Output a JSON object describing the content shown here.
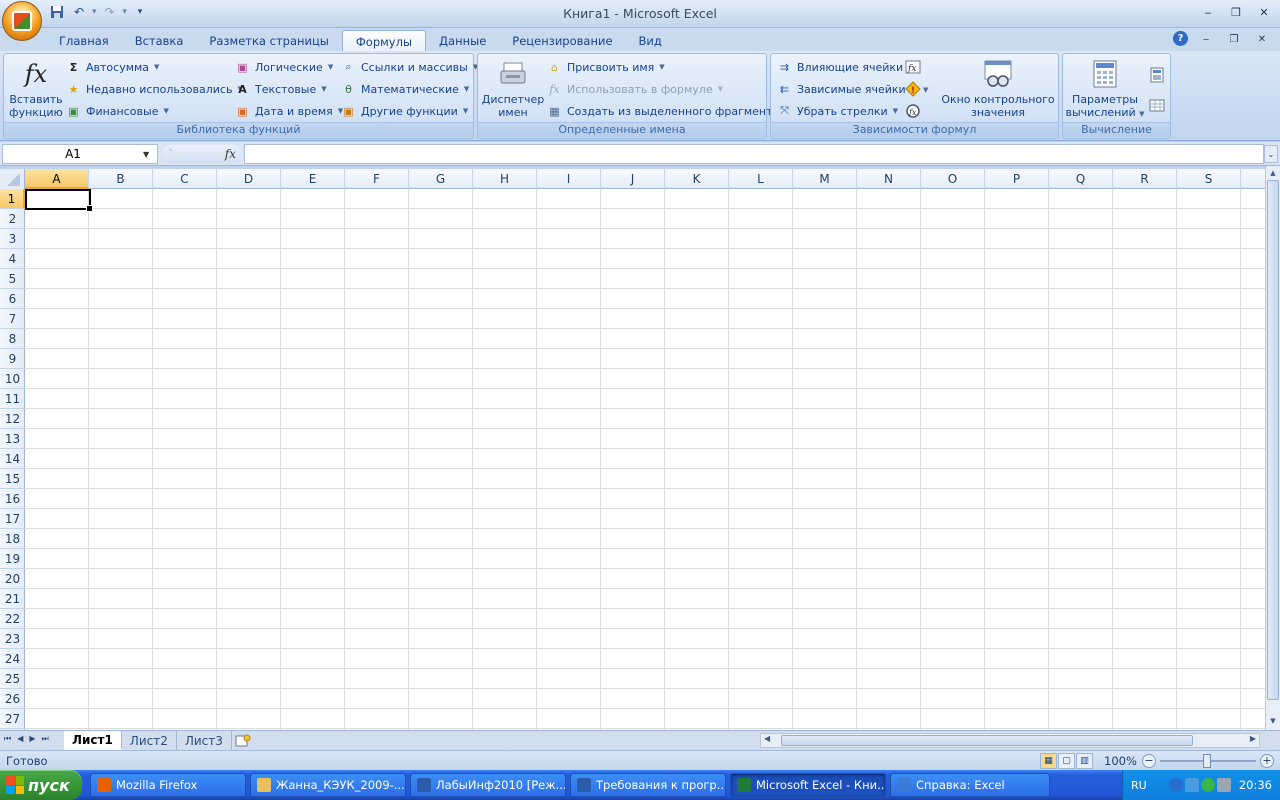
{
  "window": {
    "title": "Книга1 - Microsoft Excel",
    "controls": {
      "minimize": "‒",
      "restore": "❐",
      "close": "✕"
    }
  },
  "quick_access": {
    "save_icon": "save-icon",
    "undo_icon": "undo-icon",
    "redo_icon": "redo-icon",
    "customize_icon": "customize-qat-icon"
  },
  "ribbon_tabs": [
    "Главная",
    "Вставка",
    "Разметка страницы",
    "Формулы",
    "Данные",
    "Рецензирование",
    "Вид"
  ],
  "active_tab": "Формулы",
  "ribbon": {
    "function_library": {
      "label": "Библиотека функций",
      "insert_function": "Вставить функцию",
      "insert_function_line1": "Вставить",
      "insert_function_line2": "функцию",
      "autosum": "Автосумма",
      "recent": "Недавно использовались",
      "financial": "Финансовые",
      "logical": "Логические",
      "text": "Текстовые",
      "datetime": "Дата и время",
      "lookup": "Ссылки и массивы",
      "math": "Математические",
      "other": "Другие функции"
    },
    "defined_names": {
      "label": "Определенные имена",
      "manager_line1": "Диспетчер",
      "manager_line2": "имен",
      "define_name": "Присвоить имя",
      "use_in_formula": "Использовать в формуле",
      "create_from_selection": "Создать из выделенного фрагмента"
    },
    "auditing": {
      "label": "Зависимости формул",
      "trace_precedents": "Влияющие ячейки",
      "trace_dependents": "Зависимые ячейки",
      "remove_arrows": "Убрать стрелки",
      "watch_line1": "Окно контрольного",
      "watch_line2": "значения"
    },
    "calculation": {
      "label": "Вычисление",
      "options_line1": "Параметры",
      "options_line2": "вычислений"
    }
  },
  "formula_bar": {
    "name_box": "A1",
    "fx": "fx",
    "content": ""
  },
  "grid": {
    "columns": [
      "A",
      "B",
      "C",
      "D",
      "E",
      "F",
      "G",
      "H",
      "I",
      "J",
      "K",
      "L",
      "M",
      "N",
      "O",
      "P",
      "Q",
      "R",
      "S"
    ],
    "rows": [
      "1",
      "2",
      "3",
      "4",
      "5",
      "6",
      "7",
      "8",
      "9",
      "10",
      "11",
      "12",
      "13",
      "14",
      "15",
      "16",
      "17",
      "18",
      "19",
      "20",
      "21",
      "22",
      "23",
      "24",
      "25",
      "26",
      "27"
    ],
    "active_cell": "A1"
  },
  "sheets": [
    "Лист1",
    "Лист2",
    "Лист3"
  ],
  "active_sheet": "Лист1",
  "status": {
    "text": "Готово",
    "zoom": "100%",
    "zoom_level_percent": 100
  },
  "taskbar": {
    "start": "пуск",
    "tasks": [
      {
        "label": "Mozilla Firefox",
        "icon": "firefox-icon",
        "color": "#e66000"
      },
      {
        "label": "Жанна_КЭУК_2009-...",
        "icon": "folder-icon",
        "color": "#e8c15a"
      },
      {
        "label": "ЛабыИнф2010 [Реж...",
        "icon": "word-icon",
        "color": "#2a5caa"
      },
      {
        "label": "Требования к прогр...",
        "icon": "word-icon",
        "color": "#2a5caa"
      },
      {
        "label": "Microsoft Excel - Кни...",
        "icon": "excel-icon",
        "color": "#1e7b3a"
      },
      {
        "label": "Справка: Excel",
        "icon": "help-icon",
        "color": "#3a7bd5"
      }
    ],
    "active_task": 4,
    "lang": "RU",
    "clock": "20:36"
  }
}
